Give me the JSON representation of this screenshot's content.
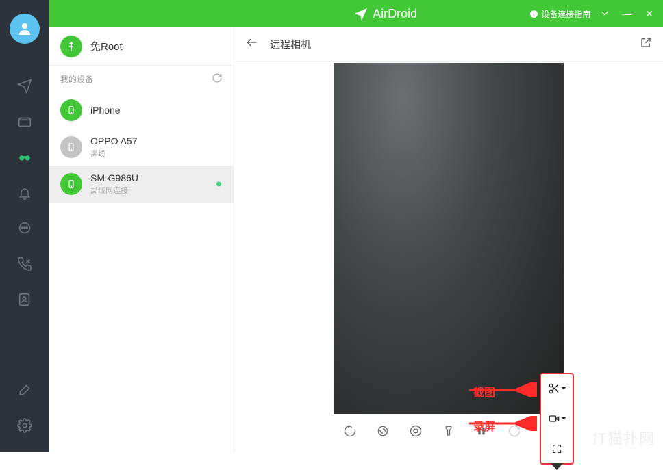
{
  "app": {
    "name": "AirDroid"
  },
  "titlebar": {
    "guide_icon": "info-icon",
    "guide_text": "设备连接指南",
    "dropdown_icon": "chevron-down",
    "minimize": "—",
    "close": "✕"
  },
  "sidebar": {
    "root_label": "免Root",
    "section_label": "我的设备",
    "devices": [
      {
        "name": "iPhone",
        "sub": "",
        "online": true
      },
      {
        "name": "OPPO A57",
        "sub": "离线",
        "online": false
      },
      {
        "name": "SM-G986U",
        "sub": "局域网连接",
        "online": true,
        "selected": true,
        "dot": true
      }
    ]
  },
  "content": {
    "title": "远程相机"
  },
  "tools": {
    "bottom": [
      "rotate",
      "switch-camera",
      "reset",
      "flashlight",
      "pause",
      "refresh",
      "more"
    ],
    "side": [
      "screenshot",
      "record",
      "fullscreen"
    ]
  },
  "annotations": {
    "screenshot": "截图",
    "record": "录屏"
  },
  "watermark": "IT猫扑网"
}
